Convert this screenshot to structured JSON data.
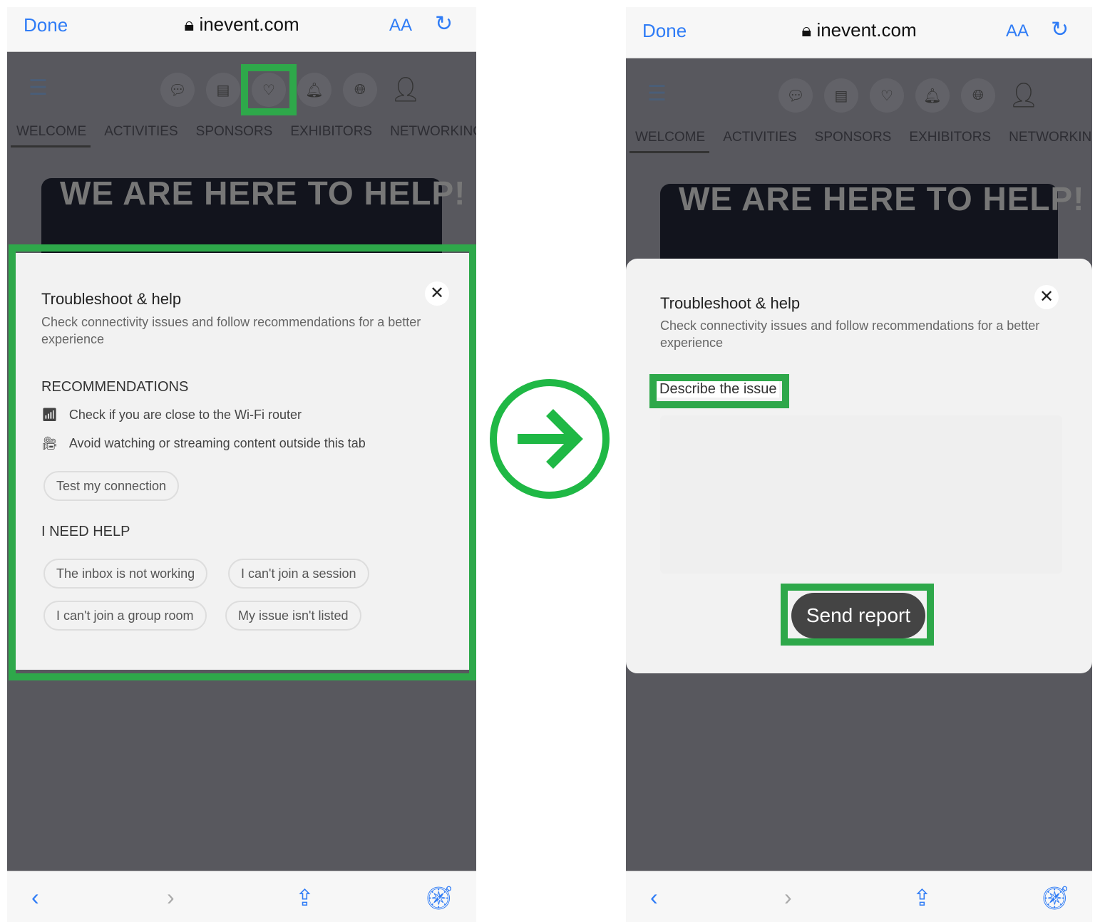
{
  "colors": {
    "accent": "#2f7cf6",
    "highlight": "#2ea84a",
    "arrow": "#1fb845",
    "send_button": "#444444"
  },
  "browser": {
    "done": "Done",
    "url": "inevent.com",
    "text_size": "AA",
    "reload_icon": "reload-icon",
    "lock_icon": "lock-icon"
  },
  "nav": [
    "WELCOME",
    "ACTIVITIES",
    "SPONSORS",
    "EXHIBITORS",
    "NETWORKING"
  ],
  "header_icons": [
    "chat-icon",
    "news-icon",
    "heart-pulse-icon",
    "bell-icon",
    "globe-icon",
    "user-avatar-icon"
  ],
  "banner": "WE ARE HERE TO HELP!",
  "modal": {
    "title": "Troubleshoot & help",
    "subtitle": "Check connectivity issues and follow recommendations for a better experience",
    "close": "✕"
  },
  "left": {
    "recommendations_heading": "RECOMMENDATIONS",
    "recommendations": [
      "Check if you are close to the Wi-Fi router",
      "Avoid watching or streaming content outside this tab"
    ],
    "test_button": "Test my connection",
    "help_heading": "I NEED HELP",
    "help_options": [
      "The inbox is not working",
      "I can't join a session",
      "I can't join a group room",
      "My issue isn't listed"
    ]
  },
  "right": {
    "describe_label": "Describe the issue",
    "textarea_value": "",
    "send_button": "Send report"
  },
  "toolbar": [
    "back-icon",
    "forward-icon",
    "share-icon",
    "compass-icon"
  ]
}
